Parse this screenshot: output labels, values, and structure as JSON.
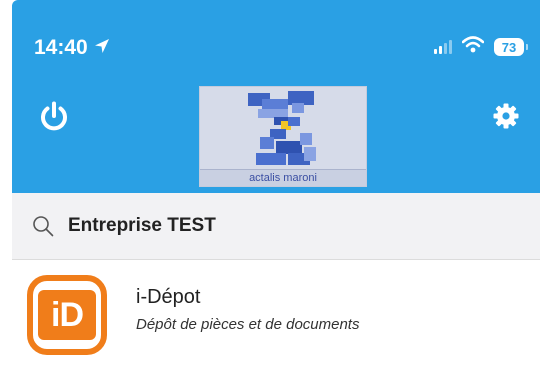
{
  "status_bar": {
    "time": "14:40",
    "battery": "73",
    "icons": [
      "location-arrow-icon",
      "signal-icon",
      "wifi-icon",
      "battery-icon"
    ]
  },
  "header": {
    "background_color": "#2aa0e4",
    "left_action_icon": "power-icon",
    "right_action_icon": "gear-icon",
    "logo_caption": "actalis maroni"
  },
  "search": {
    "icon": "search-icon",
    "value": "Entreprise TEST"
  },
  "apps": [
    {
      "icon_text": "iD",
      "icon_color": "#f07d1a",
      "title": "i-Dépot",
      "subtitle": "Dépôt de pièces et de documents"
    }
  ]
}
